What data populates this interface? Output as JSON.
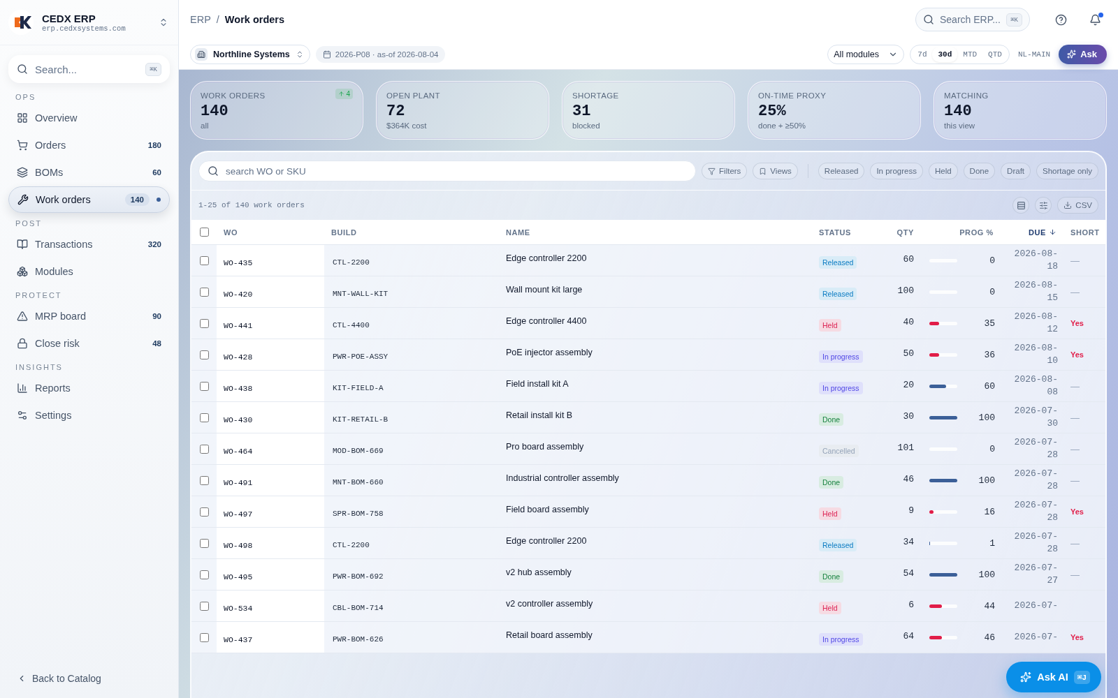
{
  "brand": {
    "name": "CEDX ERP",
    "domain": "erp.cedxsystems.com"
  },
  "sidebar": {
    "search": {
      "placeholder": "Search...",
      "shortcut": "⌘K"
    },
    "sections": [
      {
        "title": "OPS",
        "items": [
          {
            "label": "Overview",
            "selected": false
          },
          {
            "label": "Orders",
            "count": "180",
            "selected": false
          },
          {
            "label": "BOMs",
            "count": "60",
            "selected": false
          },
          {
            "label": "Work orders",
            "count": "140",
            "selected": true
          }
        ]
      },
      {
        "title": "POST",
        "items": [
          {
            "label": "Transactions",
            "count": "320",
            "selected": false
          },
          {
            "label": "Modules",
            "selected": false
          }
        ]
      },
      {
        "title": "PROTECT",
        "items": [
          {
            "label": "MRP board",
            "count": "90",
            "selected": false
          },
          {
            "label": "Close risk",
            "count": "48",
            "selected": false
          }
        ]
      },
      {
        "title": "INSIGHTS",
        "items": [
          {
            "label": "Reports",
            "selected": false
          },
          {
            "label": "Settings",
            "selected": false
          }
        ]
      }
    ],
    "back_link": "Back to Catalog"
  },
  "header": {
    "breadcrumb": [
      "ERP",
      "/",
      "Work orders"
    ],
    "search": {
      "placeholder": "Search ERP...",
      "shortcut": "⌘K"
    }
  },
  "toolbar": {
    "company": "Northline Systems",
    "period": "2026-P08 · as-of 2026-08-04",
    "module_select": "All modules",
    "ranges": [
      {
        "label": "7d",
        "selected": false
      },
      {
        "label": "30d",
        "selected": true
      },
      {
        "label": "MTD",
        "selected": false
      },
      {
        "label": "QTD",
        "selected": false
      }
    ],
    "site": "NL-MAIN",
    "ask_button": "Ask"
  },
  "kpis": [
    {
      "label": "WORK ORDERS",
      "value": "140",
      "sub": "all",
      "delta": "4"
    },
    {
      "label": "OPEN PLANT",
      "value": "72",
      "sub": "$364K cost"
    },
    {
      "label": "SHORTAGE",
      "value": "31",
      "sub": "blocked"
    },
    {
      "label": "ON-TIME PROXY",
      "value": "25%",
      "sub": "done + ≥50%"
    },
    {
      "label": "MATCHING",
      "value": "140",
      "sub": "this view"
    }
  ],
  "filters": {
    "search_placeholder": "search WO or SKU",
    "filters_button": "Filters",
    "views_button": "Views",
    "chips": [
      {
        "label": "Released",
        "selected": false
      },
      {
        "label": "In progress",
        "selected": false
      },
      {
        "label": "Held",
        "selected": false
      },
      {
        "label": "Done",
        "selected": false
      },
      {
        "label": "Draft",
        "selected": false
      },
      {
        "label": "Shortage only",
        "selected": false
      }
    ]
  },
  "summary": "1-25 of 140 work orders",
  "csv_button": "CSV",
  "table": {
    "select_all_checked": false,
    "columns": [
      {
        "label": "WO",
        "sorted": false
      },
      {
        "label": "BUILD",
        "sorted": false
      },
      {
        "label": "NAME",
        "sorted": false
      },
      {
        "label": "STATUS",
        "sorted": false
      },
      {
        "label": "QTY",
        "sorted": false
      },
      {
        "label": "PROG %",
        "sorted": false
      },
      {
        "label": "DUE",
        "sorted": true
      },
      {
        "label": "SHORT",
        "sorted": false
      }
    ],
    "rows": [
      {
        "wo": "WO-435",
        "build": "CTL-2200",
        "name": "Edge controller 2200",
        "status": "Released",
        "kind": "released",
        "qty": "60",
        "level": 0,
        "prog": "0",
        "due": "2026-08-18",
        "short": "—",
        "shortage": false,
        "checked": false
      },
      {
        "wo": "WO-420",
        "build": "MNT-WALL-KIT",
        "name": "Wall mount kit large",
        "status": "Released",
        "kind": "released",
        "qty": "100",
        "level": 0,
        "prog": "0",
        "due": "2026-08-15",
        "short": "—",
        "shortage": false,
        "checked": false
      },
      {
        "wo": "WO-441",
        "build": "CTL-4400",
        "name": "Edge controller 4400",
        "status": "Held",
        "kind": "held",
        "qty": "40",
        "level": 0.35,
        "prog": "35",
        "due": "2026-08-12",
        "short": "Yes",
        "shortage": true,
        "checked": false
      },
      {
        "wo": "WO-428",
        "build": "PWR-POE-ASSY",
        "name": "PoE injector assembly",
        "status": "In progress",
        "kind": "in_progress",
        "qty": "50",
        "level": 0.36,
        "prog": "36",
        "due": "2026-08-10",
        "short": "Yes",
        "shortage": true,
        "checked": false
      },
      {
        "wo": "WO-438",
        "build": "KIT-FIELD-A",
        "name": "Field install kit A",
        "status": "In progress",
        "kind": "in_progress",
        "qty": "20",
        "level": 0.6,
        "prog": "60",
        "due": "2026-08-08",
        "short": "—",
        "shortage": false,
        "checked": false
      },
      {
        "wo": "WO-430",
        "build": "KIT-RETAIL-B",
        "name": "Retail install kit B",
        "status": "Done",
        "kind": "done",
        "qty": "30",
        "level": 1,
        "prog": "100",
        "due": "2026-07-30",
        "short": "—",
        "shortage": false,
        "checked": false
      },
      {
        "wo": "WO-464",
        "build": "MOD-BOM-669",
        "name": "Pro board assembly",
        "status": "Cancelled",
        "kind": "cancelled",
        "qty": "101",
        "level": 0,
        "prog": "0",
        "due": "2026-07-28",
        "short": "—",
        "shortage": false,
        "checked": false
      },
      {
        "wo": "WO-491",
        "build": "MNT-BOM-660",
        "name": "Industrial controller assembly",
        "status": "Done",
        "kind": "done",
        "qty": "46",
        "level": 1,
        "prog": "100",
        "due": "2026-07-28",
        "short": "—",
        "shortage": false,
        "checked": false
      },
      {
        "wo": "WO-497",
        "build": "SPR-BOM-758",
        "name": "Field board assembly",
        "status": "Held",
        "kind": "held",
        "qty": "9",
        "level": 0.16,
        "prog": "16",
        "due": "2026-07-28",
        "short": "Yes",
        "shortage": true,
        "checked": false
      },
      {
        "wo": "WO-498",
        "build": "CTL-2200",
        "name": "Edge controller 2200",
        "status": "Released",
        "kind": "released",
        "qty": "34",
        "level": 0.01,
        "prog": "1",
        "due": "2026-07-28",
        "short": "—",
        "shortage": false,
        "checked": false
      },
      {
        "wo": "WO-495",
        "build": "PWR-BOM-692",
        "name": "v2 hub assembly",
        "status": "Done",
        "kind": "done",
        "qty": "54",
        "level": 1,
        "prog": "100",
        "due": "2026-07-27",
        "short": "—",
        "shortage": false,
        "checked": false
      },
      {
        "wo": "WO-534",
        "build": "CBL-BOM-714",
        "name": "v2 controller assembly",
        "status": "Held",
        "kind": "held",
        "qty": "6",
        "level": 0.44,
        "prog": "44",
        "due": "2026-07-",
        "shortage": true,
        "checked": false
      },
      {
        "wo": "WO-437",
        "build": "PWR-BOM-626",
        "name": "Retail board assembly",
        "status": "In progress",
        "kind": "in_progress",
        "qty": "64",
        "level": 0.46,
        "prog": "46",
        "due": "2026-07-",
        "short": "Yes",
        "shortage": true,
        "checked": false
      }
    ]
  },
  "ask_ai": {
    "label": "Ask AI",
    "shortcut": "⌘J"
  }
}
